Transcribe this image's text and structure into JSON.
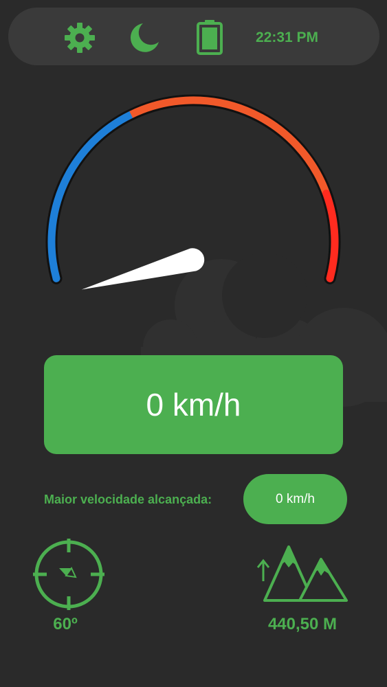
{
  "status_bar": {
    "icons": [
      "gear-icon",
      "moon-icon",
      "battery-icon"
    ],
    "time": "22:31 PM"
  },
  "gauge": {
    "speed_fraction": 0,
    "colors": {
      "low": "#1e7fd8",
      "mid": "#f1592a",
      "high": "#ff2b1f"
    }
  },
  "speed": {
    "display": "0 km/h"
  },
  "max_speed": {
    "label": "Maior velocidade alcançada:",
    "value": "0 km/h"
  },
  "compass": {
    "icon": "compass-icon",
    "heading": "60º"
  },
  "altitude": {
    "icon": "mountains-icon",
    "value": "440,50 M"
  },
  "colors": {
    "accent": "#4caf50",
    "background": "#2a2a2a",
    "bar": "#3a3a3a"
  }
}
